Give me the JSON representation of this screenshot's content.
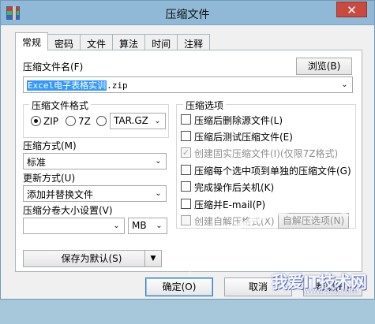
{
  "window": {
    "title": "压缩文件",
    "close_symbol": "✕"
  },
  "tabs": [
    {
      "label": "常规",
      "active": true
    },
    {
      "label": "密码"
    },
    {
      "label": "文件"
    },
    {
      "label": "算法"
    },
    {
      "label": "时间"
    },
    {
      "label": "注释"
    }
  ],
  "archive_name": {
    "label": "压缩文件名(F)",
    "browse_label": "浏览(B)",
    "selected_part": "Excel电子表格实训",
    "extension": ".zip"
  },
  "format": {
    "title": "压缩文件格式",
    "options": [
      "ZIP",
      "7Z"
    ],
    "other_option_value": "TAR.GZ"
  },
  "compression_method": {
    "label": "压缩方式(M)",
    "value": "标准"
  },
  "update_method": {
    "label": "更新方式(U)",
    "value": "添加并替换文件"
  },
  "split_size": {
    "label": "压缩分卷大小设置(V)",
    "value": "",
    "unit": "MB"
  },
  "options": {
    "title": "压缩选项",
    "items": [
      {
        "label": "压缩后删除源文件(L)",
        "checked": false,
        "disabled": false
      },
      {
        "label": "压缩后测试压缩文件(E)",
        "checked": false,
        "disabled": false
      },
      {
        "label": "创建固实压缩文件(I)(仅限7Z格式)",
        "checked": true,
        "disabled": true
      },
      {
        "label": "压缩每个选中项到单独的压缩文件(G)",
        "checked": false,
        "disabled": false
      },
      {
        "label": "完成操作后关机(K)",
        "checked": false,
        "disabled": false
      },
      {
        "label": "压缩并E-mail(P)",
        "checked": false,
        "disabled": false
      },
      {
        "label": "创建自解压格式(X)",
        "checked": false,
        "disabled": true
      }
    ],
    "sfx_options_label": "自解压选项(N)"
  },
  "save_default": {
    "label": "保存为默认(S)",
    "arrow": "▼"
  },
  "buttons": {
    "ok": "确定(O)",
    "cancel": "取消",
    "help": "帮助(H)"
  },
  "watermark": {
    "main": "我爱IT技术网",
    "sub": "www.52ij.com"
  },
  "colors": {
    "selection": "#3399ff",
    "titlebar": "#8fb9d6",
    "close": "#c94b3f"
  }
}
